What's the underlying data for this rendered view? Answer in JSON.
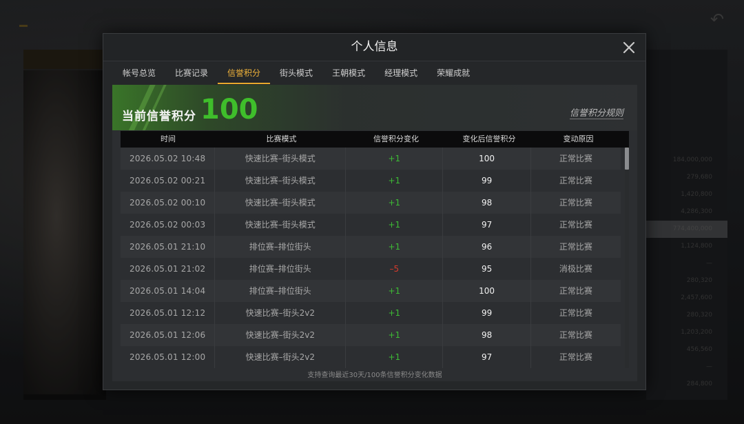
{
  "dialog": {
    "title": "个人信息",
    "close_icon": "close-icon"
  },
  "tabs": [
    {
      "label": "帐号总览",
      "active": false
    },
    {
      "label": "比赛记录",
      "active": false
    },
    {
      "label": "信誉积分",
      "active": true
    },
    {
      "label": "街头模式",
      "active": false
    },
    {
      "label": "王朝模式",
      "active": false
    },
    {
      "label": "经理模式",
      "active": false
    },
    {
      "label": "荣耀成就",
      "active": false
    }
  ],
  "banner": {
    "label": "当前信誉积分",
    "score": "100",
    "rules_link": "信誉积分规则"
  },
  "table": {
    "headers": [
      "时间",
      "比赛模式",
      "信誉积分变化",
      "变化后信誉积分",
      "变动原因"
    ],
    "rows": [
      {
        "time": "2026.05.02  10:48",
        "mode": "快速比赛–街头模式",
        "change": "+1",
        "after": "100",
        "reason": "正常比赛"
      },
      {
        "time": "2026.05.02  00:21",
        "mode": "快速比赛–街头模式",
        "change": "+1",
        "after": "99",
        "reason": "正常比赛"
      },
      {
        "time": "2026.05.02  00:10",
        "mode": "快速比赛–街头模式",
        "change": "+1",
        "after": "98",
        "reason": "正常比赛"
      },
      {
        "time": "2026.05.02  00:03",
        "mode": "快速比赛–街头模式",
        "change": "+1",
        "after": "97",
        "reason": "正常比赛"
      },
      {
        "time": "2026.05.01  21:10",
        "mode": "排位赛–排位街头",
        "change": "+1",
        "after": "96",
        "reason": "正常比赛"
      },
      {
        "time": "2026.05.01  21:02",
        "mode": "排位赛–排位街头",
        "change": "–5",
        "after": "95",
        "reason": "消极比赛"
      },
      {
        "time": "2026.05.01  14:04",
        "mode": "排位赛–排位街头",
        "change": "+1",
        "after": "100",
        "reason": "正常比赛"
      },
      {
        "time": "2026.05.01  12:12",
        "mode": "快速比赛–街头2v2",
        "change": "+1",
        "after": "99",
        "reason": "正常比赛"
      },
      {
        "time": "2026.05.01  12:06",
        "mode": "快速比赛–街头2v2",
        "change": "+1",
        "after": "98",
        "reason": "正常比赛"
      },
      {
        "time": "2026.05.01  12:00",
        "mode": "快速比赛–街头2v2",
        "change": "+1",
        "after": "97",
        "reason": "正常比赛"
      }
    ],
    "footer_note": "支持查询最近30天/100条信誉积分变化数据"
  },
  "colors": {
    "accent": "#e8a92c",
    "positive": "#3dbb35",
    "negative": "#d63a2c",
    "score": "#3fbe2b"
  },
  "background": {
    "right_values": [
      "184,000,000",
      "279,680",
      "1,420,800",
      "4,286,300",
      "774,400,000",
      "1,124,800",
      "—",
      "280,320",
      "2,457,600",
      "280,320",
      "1,203,200",
      "456,560",
      "—",
      "284,800"
    ]
  }
}
